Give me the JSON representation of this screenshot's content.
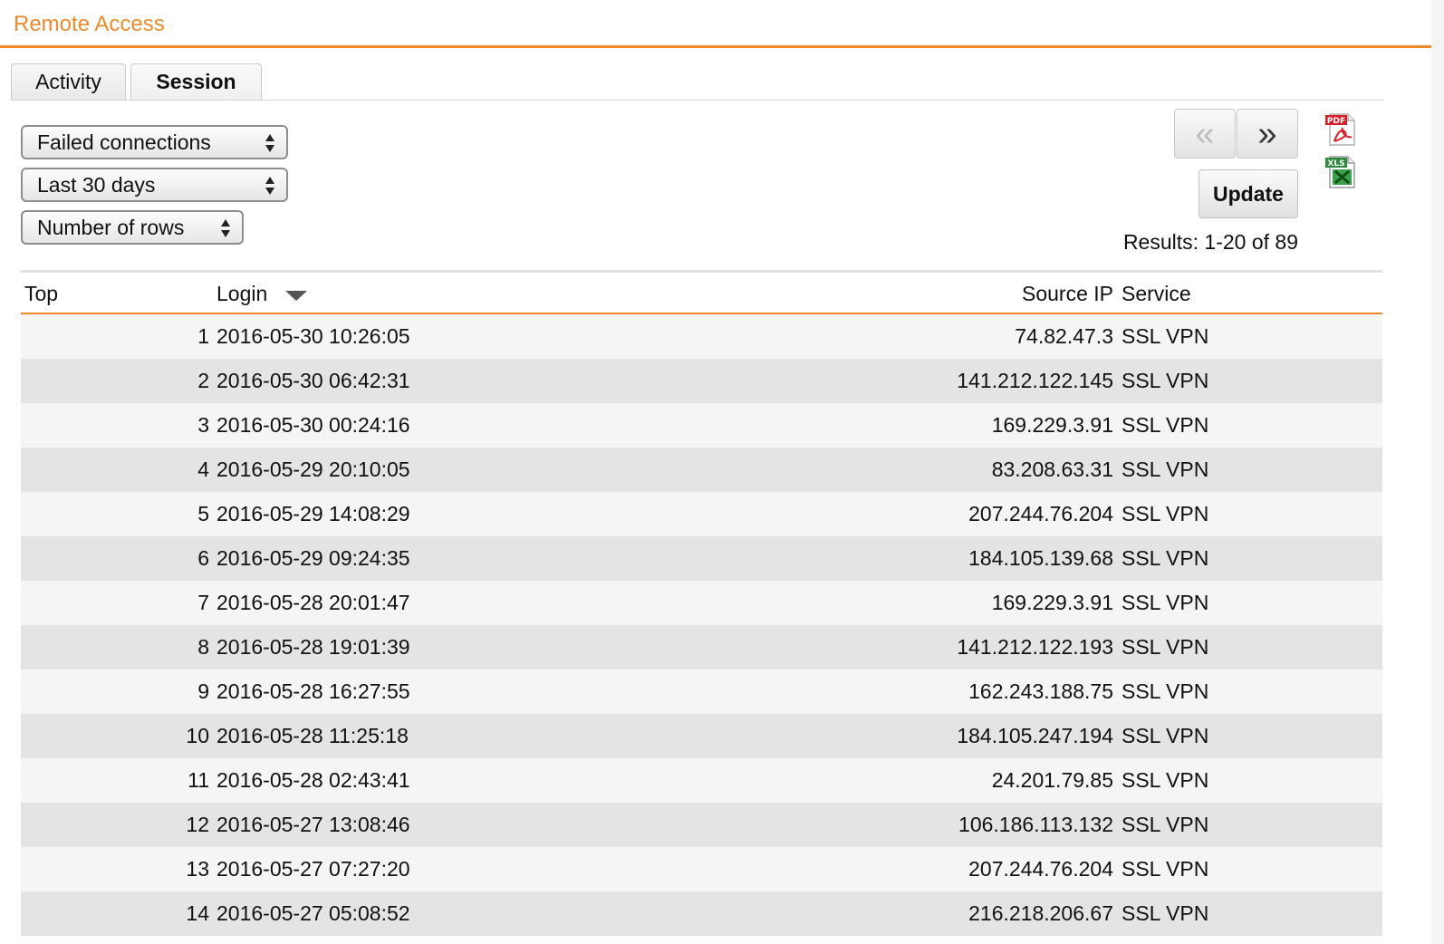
{
  "app": {
    "title": "Remote Access"
  },
  "tabs": [
    {
      "label": "Activity",
      "active": false
    },
    {
      "label": "Session",
      "active": true
    }
  ],
  "filters": {
    "type": "Failed connections",
    "period": "Last 30 days",
    "rows": "Number of rows"
  },
  "pager": {
    "prev": "«",
    "next": "»",
    "update": "Update",
    "results": "Results: 1-20 of 89"
  },
  "export": {
    "pdf_icon": "pdf-export-icon",
    "xls_icon": "xls-export-icon"
  },
  "colors": {
    "accent": "#ee8a2c"
  },
  "table": {
    "headers": {
      "top": "Top",
      "login": "Login",
      "source_ip": "Source IP",
      "service": "Service"
    },
    "sort": {
      "column": "Login",
      "direction": "descending"
    },
    "rows": [
      {
        "top": "1",
        "login": "2016-05-30 10:26:05",
        "ip": "74.82.47.3",
        "service": "SSL VPN"
      },
      {
        "top": "2",
        "login": "2016-05-30 06:42:31",
        "ip": "141.212.122.145",
        "service": "SSL VPN"
      },
      {
        "top": "3",
        "login": "2016-05-30 00:24:16",
        "ip": "169.229.3.91",
        "service": "SSL VPN"
      },
      {
        "top": "4",
        "login": "2016-05-29 20:10:05",
        "ip": "83.208.63.31",
        "service": "SSL VPN"
      },
      {
        "top": "5",
        "login": "2016-05-29 14:08:29",
        "ip": "207.244.76.204",
        "service": "SSL VPN"
      },
      {
        "top": "6",
        "login": "2016-05-29 09:24:35",
        "ip": "184.105.139.68",
        "service": "SSL VPN"
      },
      {
        "top": "7",
        "login": "2016-05-28 20:01:47",
        "ip": "169.229.3.91",
        "service": "SSL VPN"
      },
      {
        "top": "8",
        "login": "2016-05-28 19:01:39",
        "ip": "141.212.122.193",
        "service": "SSL VPN"
      },
      {
        "top": "9",
        "login": "2016-05-28 16:27:55",
        "ip": "162.243.188.75",
        "service": "SSL VPN"
      },
      {
        "top": "10",
        "login": "2016-05-28 11:25:18",
        "ip": "184.105.247.194",
        "service": "SSL VPN"
      },
      {
        "top": "11",
        "login": "2016-05-28 02:43:41",
        "ip": "24.201.79.85",
        "service": "SSL VPN"
      },
      {
        "top": "12",
        "login": "2016-05-27 13:08:46",
        "ip": "106.186.113.132",
        "service": "SSL VPN"
      },
      {
        "top": "13",
        "login": "2016-05-27 07:27:20",
        "ip": "207.244.76.204",
        "service": "SSL VPN"
      },
      {
        "top": "14",
        "login": "2016-05-27 05:08:52",
        "ip": "216.218.206.67",
        "service": "SSL VPN"
      }
    ]
  }
}
